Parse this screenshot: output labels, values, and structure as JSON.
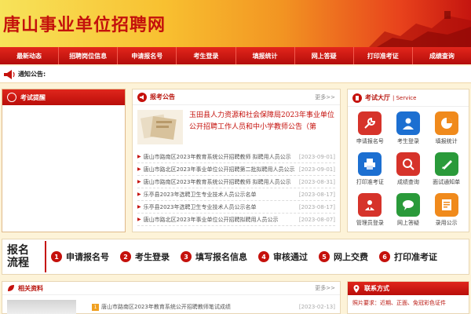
{
  "header": {
    "title": "唐山事业单位招聘网"
  },
  "nav": [
    "最新动态",
    "招聘岗位信息",
    "申请报名号",
    "考生登录",
    "填报统计",
    "网上答疑",
    "打印准考证",
    "成绩查询"
  ],
  "notice": {
    "label": "通知公告:"
  },
  "exam_reminder": {
    "title": "考试提醒"
  },
  "announce": {
    "title": "报考公告",
    "more": "更多>>",
    "featured": "玉田县人力资源和社会保障局2023年事业单位公开招聘工作人员和中小学教师公告（第",
    "items": [
      {
        "text": "唐山市路南区2023年教育系统公开招聘教师 拟聘用人员公示",
        "date": "[2023-09-01]"
      },
      {
        "text": "唐山市路北区2023年事业单位公开招聘第二批拟聘用人员公示",
        "date": "[2023-09-01]"
      },
      {
        "text": "唐山市路南区2023年教育系统公开招聘教师 拟聘用人员公示",
        "date": "[2023-08-31]"
      },
      {
        "text": "乐亭县2023年选聘卫生专业技术人员公示名单",
        "date": "[2023-08-17]"
      },
      {
        "text": "乐亭县2023年选聘卫生专业技术人员公示名单",
        "date": "[2023-08-17]"
      },
      {
        "text": "唐山市路北区2023年事业单位公开招聘拟聘用人员公示",
        "date": "[2023-08-07]"
      }
    ]
  },
  "hall": {
    "title": "考试大厅",
    "subtitle": "| Service",
    "items": [
      {
        "label": "申请报名号",
        "icon": "wrench-icon",
        "color": "#d6332a"
      },
      {
        "label": "考生登录",
        "icon": "user-icon",
        "color": "#1c6fd1"
      },
      {
        "label": "填报统计",
        "icon": "pie-chart-icon",
        "color": "#f08a1c"
      },
      {
        "label": "打印准考证",
        "icon": "printer-icon",
        "color": "#1c6fd1"
      },
      {
        "label": "成绩查询",
        "icon": "search-icon",
        "color": "#d6332a"
      },
      {
        "label": "面试通知单",
        "icon": "notice-icon",
        "color": "#2a9a3a"
      },
      {
        "label": "管理员登录",
        "icon": "admin-icon",
        "color": "#d6332a"
      },
      {
        "label": "网上答疑",
        "icon": "chat-icon",
        "color": "#2a9a3a"
      },
      {
        "label": "录用公示",
        "icon": "publish-icon",
        "color": "#f08a1c"
      }
    ]
  },
  "process": {
    "title_line1": "报名",
    "title_line2": "流程",
    "steps": [
      {
        "num": "1",
        "label": "申请报名号"
      },
      {
        "num": "2",
        "label": "考生登录"
      },
      {
        "num": "3",
        "label": "填写报名信息"
      },
      {
        "num": "4",
        "label": "审核通过"
      },
      {
        "num": "5",
        "label": "网上交费"
      },
      {
        "num": "6",
        "label": "打印准考证"
      }
    ]
  },
  "related": {
    "title": "相关资料",
    "more": "更多>>",
    "item": {
      "num": "1",
      "text": "唐山市路南区2023年教育系统公开招聘教师笔试成绩",
      "date": "[2023-02-13]"
    }
  },
  "contact": {
    "title": "联系方式",
    "text": "照片要求：近期、正面、免冠彩色证件"
  }
}
